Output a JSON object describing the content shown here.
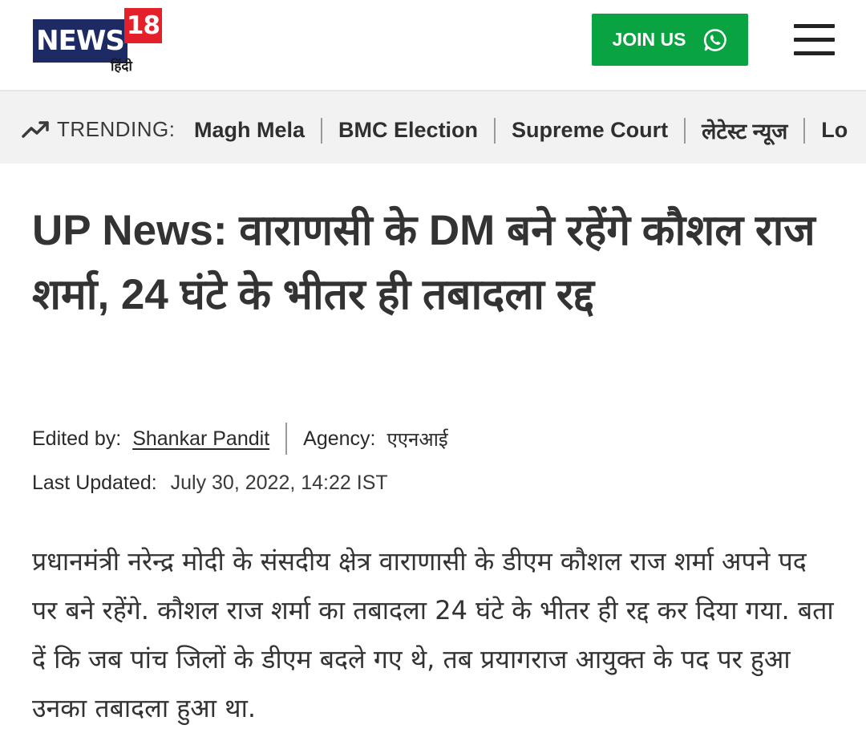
{
  "header": {
    "logo_text": "NEWS",
    "logo_number": "18",
    "logo_subtitle": "हिंदी",
    "join_label": "JOIN US",
    "join_icon": "whatsapp-icon",
    "menu_icon": "hamburger-menu-icon",
    "brand_color": "#1e2a64",
    "accent_red": "#e4212b",
    "join_color": "#0aa342"
  },
  "trending": {
    "icon": "trending-up-icon",
    "label": "TRENDING:",
    "items": [
      "Magh Mela",
      "BMC Election",
      "Supreme Court",
      "लेटेस्ट न्यूज",
      "Lo"
    ]
  },
  "article": {
    "headline": "UP News: वाराणसी के DM बने रहेंगे कौशल राज शर्मा, 24 घंटे के भीतर ही तबादला रद्द",
    "edited_by_label": "Edited by:",
    "editor": "Shankar Pandit",
    "agency_label": "Agency:",
    "agency": "एएनआई",
    "updated_label": "Last Updated:",
    "updated_value": "July 30, 2022, 14:22 IST",
    "body": "प्रधानमंत्री नरेन्द्र मोदी के संसदीय क्षेत्र वाराणासी के डीएम कौशल राज शर्मा अपने पद पर बने रहेंगे. कौशल राज शर्मा का तबादला 24 घंटे के भीतर ही रद्द कर दिया गया. बता दें कि जब पांच जिलों के डीएम बदले गए थे, तब प्रयागराज आयुक्त के पद पर हुआ उनका तबादला हुआ था."
  }
}
